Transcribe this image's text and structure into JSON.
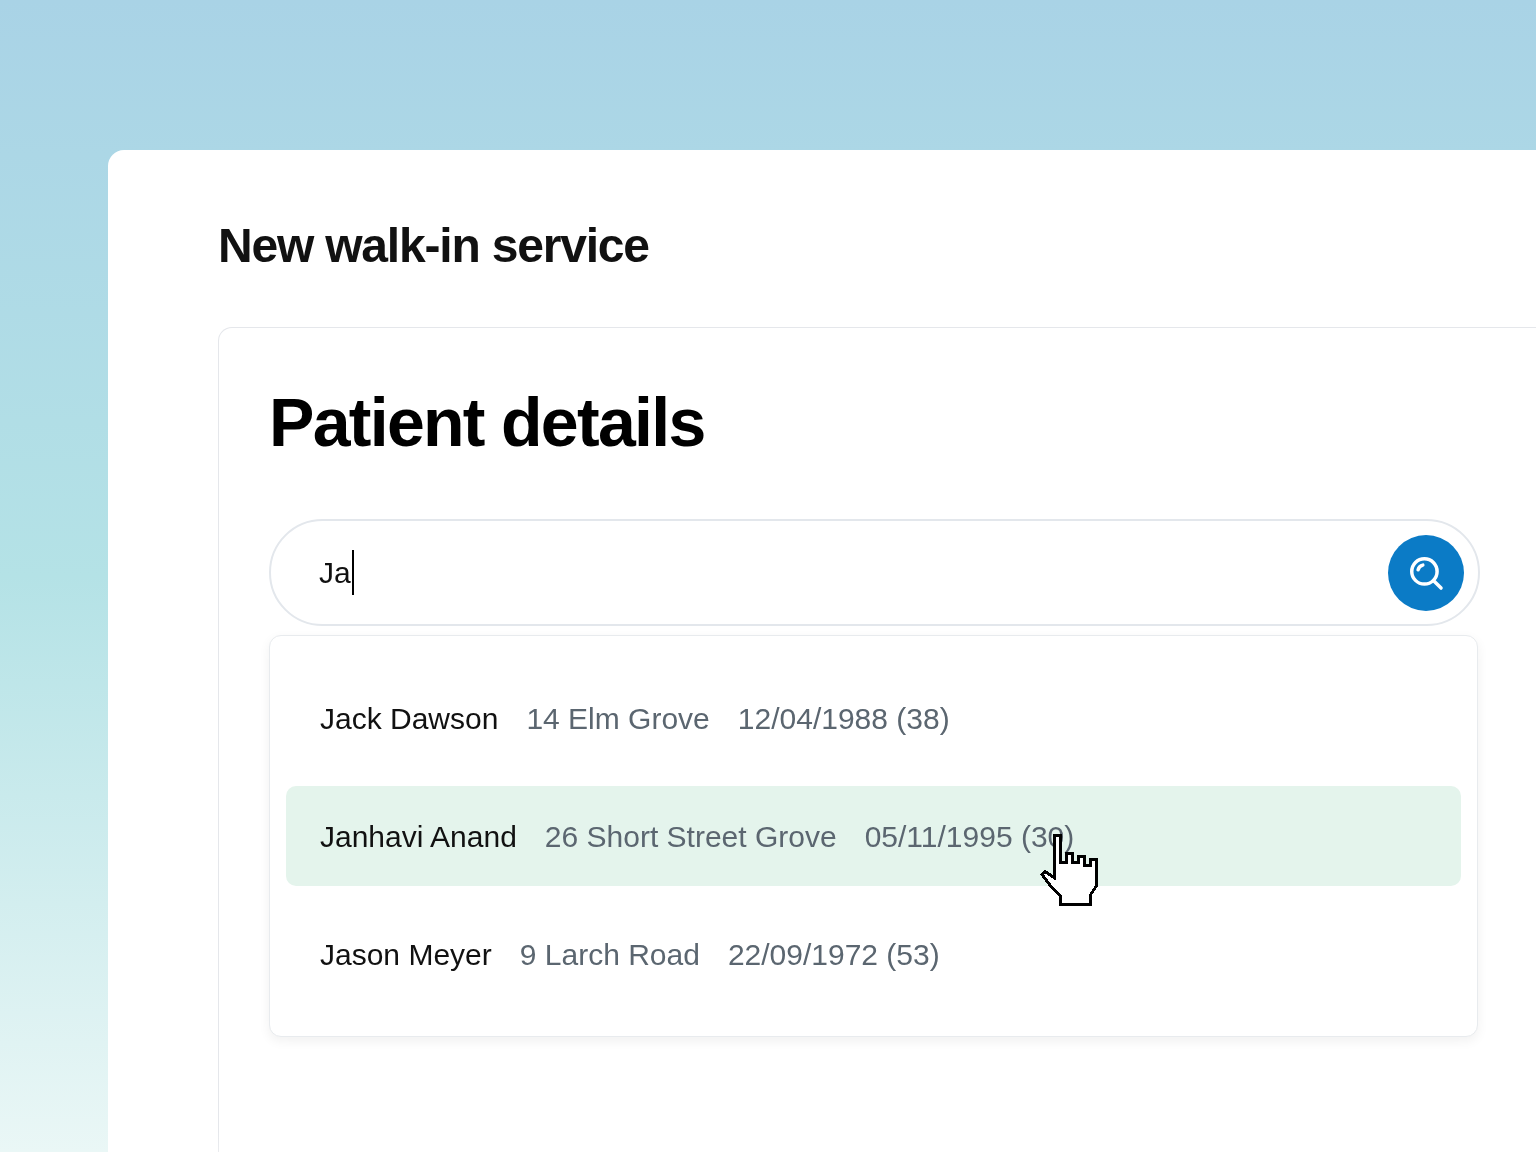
{
  "page": {
    "title": "New walk-in service"
  },
  "card": {
    "title": "Patient details"
  },
  "search": {
    "value": "Ja"
  },
  "results": [
    {
      "name": "Jack Dawson",
      "address": "14 Elm Grove",
      "dob": "12/04/1988 (38)",
      "selected": false
    },
    {
      "name": "Janhavi Anand",
      "address": "26 Short Street Grove",
      "dob": "05/11/1995 (30)",
      "selected": true
    },
    {
      "name": "Jason Meyer",
      "address": "9 Larch Road",
      "dob": "22/09/1972 (53)",
      "selected": false
    }
  ]
}
